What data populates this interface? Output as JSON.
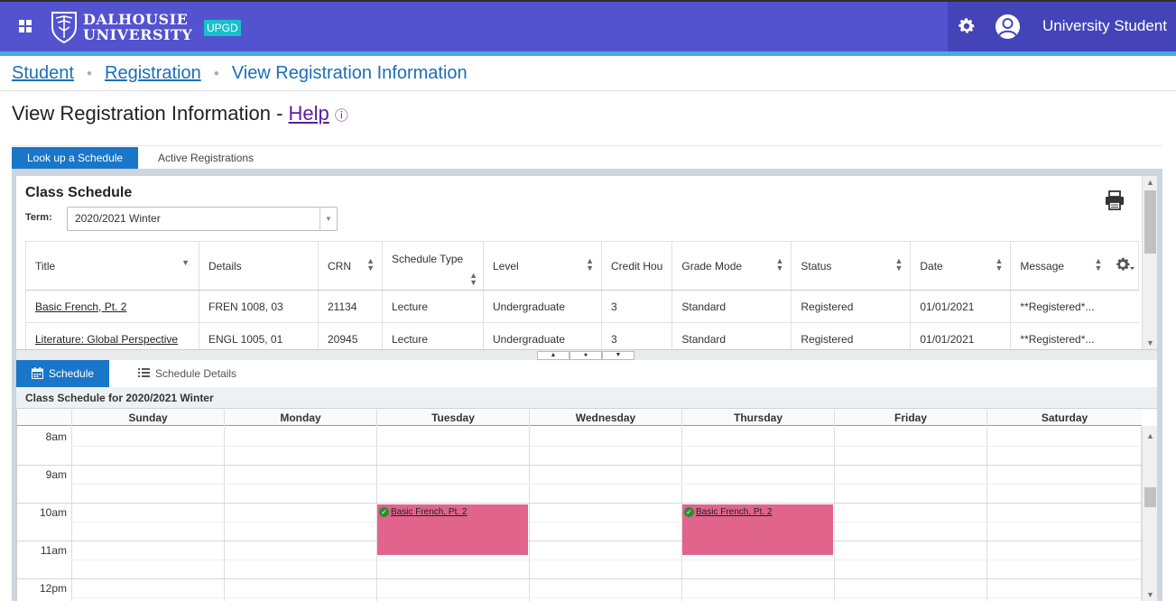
{
  "header": {
    "logo_line1": "DALHOUSIE",
    "logo_line2": "UNIVERSITY",
    "badge": "UPGD",
    "user_name": "University Student"
  },
  "breadcrumb": {
    "items": [
      "Student",
      "Registration"
    ],
    "current": "View Registration Information"
  },
  "page": {
    "title": "View Registration Information -",
    "help_label": "Help",
    "help_icon": "ⓘ"
  },
  "tabs": {
    "active": "Look up a Schedule",
    "inactive": "Active Registrations"
  },
  "class_schedule": {
    "title": "Class Schedule",
    "term_label": "Term:",
    "term_value": "2020/2021 Winter",
    "columns": [
      "Title",
      "Details",
      "CRN",
      "Schedule Type",
      "Level",
      "Credit Hou",
      "Grade Mode",
      "Status",
      "Date",
      "Message"
    ],
    "rows": [
      [
        "Basic French, Pt. 2",
        "FREN 1008, 03",
        "21134",
        "Lecture",
        "Undergraduate",
        "3",
        "Standard",
        "Registered",
        "01/01/2021",
        "**Registered*..."
      ],
      [
        "Literature: Global Perspective",
        "ENGL 1005, 01",
        "20945",
        "Lecture",
        "Undergraduate",
        "3",
        "Standard",
        "Registered",
        "01/01/2021",
        "**Registered*..."
      ]
    ]
  },
  "schedule": {
    "tab_active": "Schedule",
    "tab_inactive": "Schedule Details",
    "caption": "Class Schedule for 2020/2021 Winter",
    "days": [
      "Sunday",
      "Monday",
      "Tuesday",
      "Wednesday",
      "Thursday",
      "Friday",
      "Saturday"
    ],
    "hours": [
      "8am",
      "9am",
      "10am",
      "11am",
      "12pm"
    ],
    "events": [
      {
        "title": "Basic French, Pt. 2",
        "day": "Tuesday",
        "start": "10:00",
        "end": "11:20"
      },
      {
        "title": "Basic French, Pt. 2",
        "day": "Thursday",
        "start": "10:00",
        "end": "11:20"
      }
    ]
  },
  "colors": {
    "header_bg": "#5353d0",
    "accent": "#1a76c8",
    "event_bg": "#e0648c",
    "badge_bg": "#18c0c9"
  }
}
